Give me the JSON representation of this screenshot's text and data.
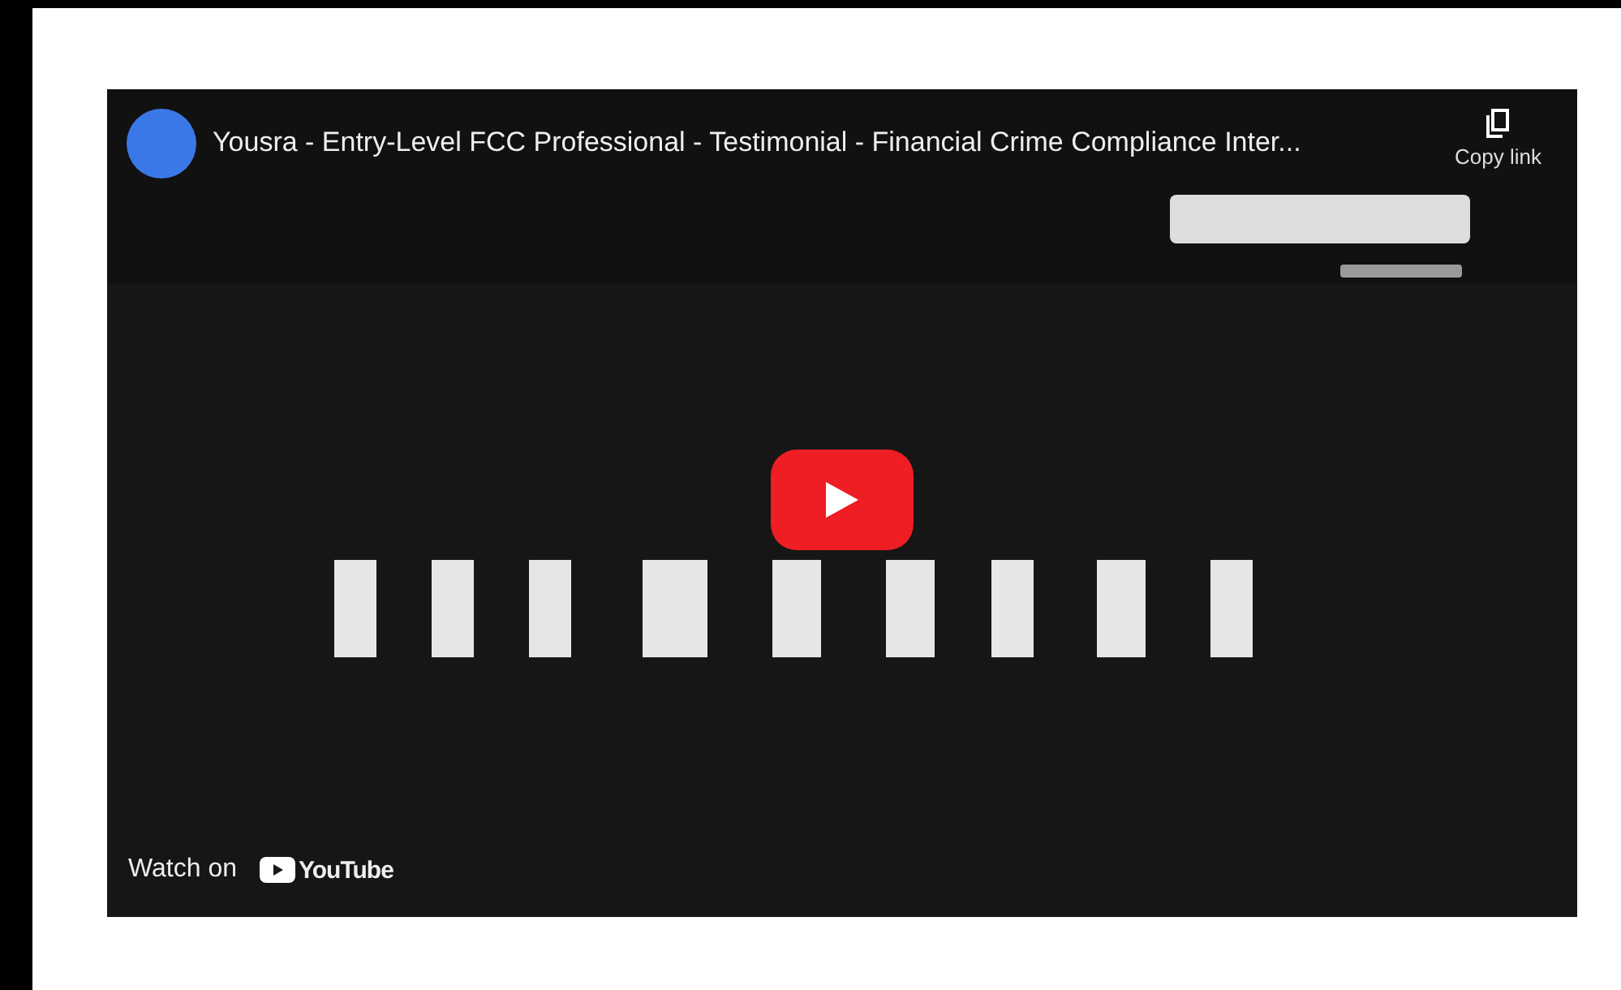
{
  "video": {
    "kind": "picture",
    "title": "Yousra - Entry-Level FCC Professional - Testimonial - Financial Crime Compliance Inter...",
    "copy_link": "Copy link",
    "watch_on": "Watch on",
    "platform": "YouTube"
  }
}
